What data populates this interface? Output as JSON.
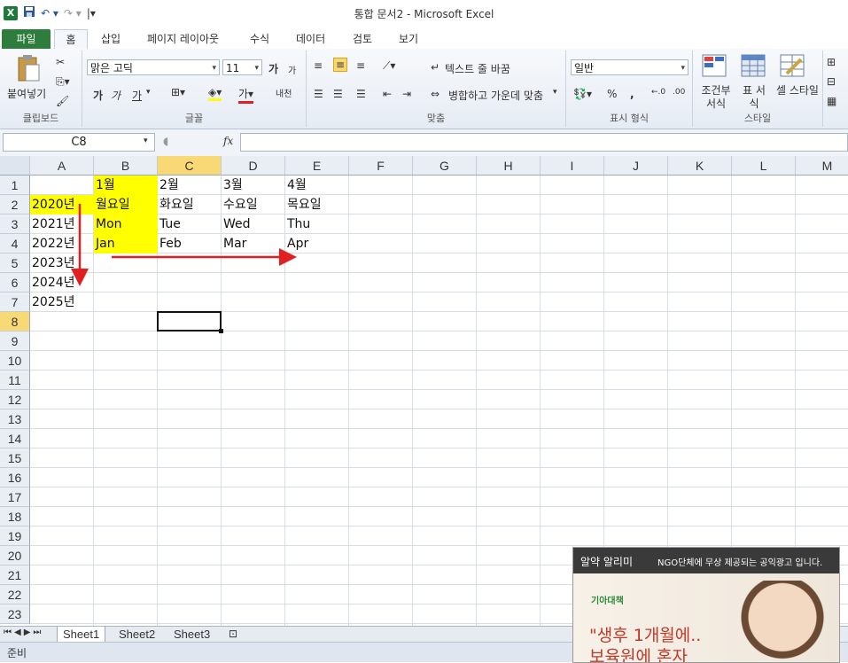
{
  "window": {
    "title": "통합 문서2 - Microsoft Excel"
  },
  "qat": {
    "logo": "X"
  },
  "tabs": [
    {
      "label": "파일"
    },
    {
      "label": "홈"
    },
    {
      "label": "삽입"
    },
    {
      "label": "페이지 레이아웃"
    },
    {
      "label": "수식"
    },
    {
      "label": "데이터"
    },
    {
      "label": "검토"
    },
    {
      "label": "보기"
    }
  ],
  "ribbon": {
    "clipboard": {
      "paste": "붙여넣기",
      "label": "클립보드"
    },
    "font": {
      "name": "맑은 고딕",
      "size": "11",
      "bold": "가",
      "italic": "가",
      "underline": "가",
      "grow": "가",
      "shrink": "가",
      "label": "글꼴",
      "phonetic": "내천"
    },
    "alignment": {
      "wrap": "텍스트 줄 바꿈",
      "merge": "병합하고 가운데 맞춤",
      "label": "맞춤"
    },
    "number": {
      "format": "일반",
      "percent": "%",
      "comma": ",",
      "label": "표시 형식"
    },
    "styles": {
      "conditional": "조건부 서식",
      "table": "표 서식",
      "cell": "셀 스타일",
      "label": "스타일"
    }
  },
  "formula_bar": {
    "name_box": "C8",
    "fx": "fx",
    "value": ""
  },
  "columns": [
    "A",
    "B",
    "C",
    "D",
    "E",
    "F",
    "G",
    "H",
    "I",
    "J",
    "K",
    "L",
    "M"
  ],
  "rows": [
    "1",
    "2",
    "3",
    "4",
    "5",
    "6",
    "7",
    "8",
    "9",
    "10",
    "11",
    "12",
    "13",
    "14",
    "15",
    "16",
    "17",
    "18",
    "19",
    "20",
    "21",
    "22",
    "23"
  ],
  "cells": {
    "B1": "1월",
    "C1": "2월",
    "D1": "3월",
    "E1": "4월",
    "A2": "2020년",
    "B2": "월요일",
    "C2": "화요일",
    "D2": "수요일",
    "E2": "목요일",
    "A3": "2021년",
    "B3": "Mon",
    "C3": "Tue",
    "D3": "Wed",
    "E3": "Thu",
    "A4": "2022년",
    "B4": "Jan",
    "C4": "Feb",
    "D4": "Mar",
    "E4": "Apr",
    "A5": "2023년",
    "A6": "2024년",
    "A7": "2025년"
  },
  "highlighted_cells": [
    "B1",
    "A2",
    "B2",
    "B3",
    "B4"
  ],
  "active_cell": "C8",
  "annotation_color": "#e02020",
  "sheets": [
    {
      "label": "Sheet1",
      "active": true
    },
    {
      "label": "Sheet2",
      "active": false
    },
    {
      "label": "Sheet3",
      "active": false
    }
  ],
  "status": {
    "text": "준비"
  },
  "ad": {
    "header_title": "알약 알리미",
    "header_text": "NGO단체에 무상 제공되는 공익광고 입니다.",
    "logo": "기아대책",
    "line1": "\"생후 1개월에..",
    "line2": "보육원에 혼자"
  }
}
